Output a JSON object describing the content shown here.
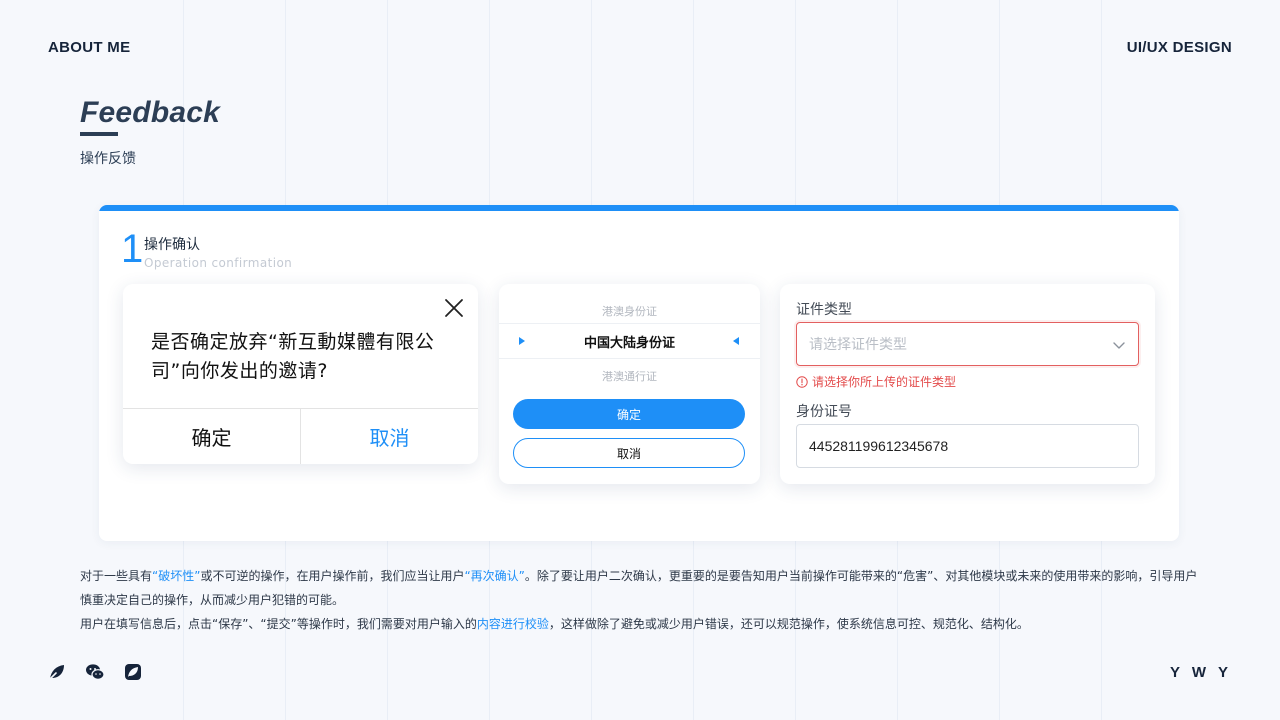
{
  "header": {
    "left_label": "ABOUT ME",
    "right_label": "UI/UX DESIGN"
  },
  "heading": {
    "title": "Feedback",
    "subtitle": "操作反馈"
  },
  "section": {
    "number": "1",
    "title": "操作确认",
    "subtitle": "Operation confirmation"
  },
  "dialog": {
    "message": "是否确定放弃“新互動媒體有限公司”向你发出的邀请?",
    "confirm_label": "确定",
    "cancel_label": "取消",
    "close_icon": "close-icon"
  },
  "picker": {
    "options": [
      "港澳身份证",
      "中国大陆身份证",
      "港澳通行证"
    ],
    "selected": "中国大陆身份证",
    "confirm_label": "确定",
    "cancel_label": "取消"
  },
  "form": {
    "type_label": "证件类型",
    "type_placeholder": "请选择证件类型",
    "type_error": "请选择你所上传的证件类型",
    "id_label": "身份证号",
    "id_value": "445281199612345678"
  },
  "description": {
    "p1_a": "对于一些具有",
    "p1_hl1": "“破坏性”",
    "p1_b": "或不可逆的操作，在用户操作前，我们应当让用户",
    "p1_hl2": "“再次确认”",
    "p1_c": "。除了要让用户二次确认，更重要的是要告知用户当前操作可能带来的“危害”、对其他模块或未来的使用带来的影响，引导用户慎重决定自己的操作，从而减少用户犯错的可能。",
    "p2_a": "用户在填写信息后，点击“保存”、“提交”等操作时，我们需要对用户输入的",
    "p2_hl": "内容进行校验",
    "p2_b": "，这样做除了避免或减少用户错误，还可以规范操作，使系统信息可控、规范化、结构化。"
  },
  "footer": {
    "icons": [
      "leaf-icon",
      "wechat-icon",
      "leaf-badge-icon"
    ],
    "signature": "Y W Y"
  },
  "colors": {
    "accent": "#1e8ff7",
    "error": "#e34b4b",
    "heading": "#2c3e55",
    "background": "#f6f8fc"
  }
}
